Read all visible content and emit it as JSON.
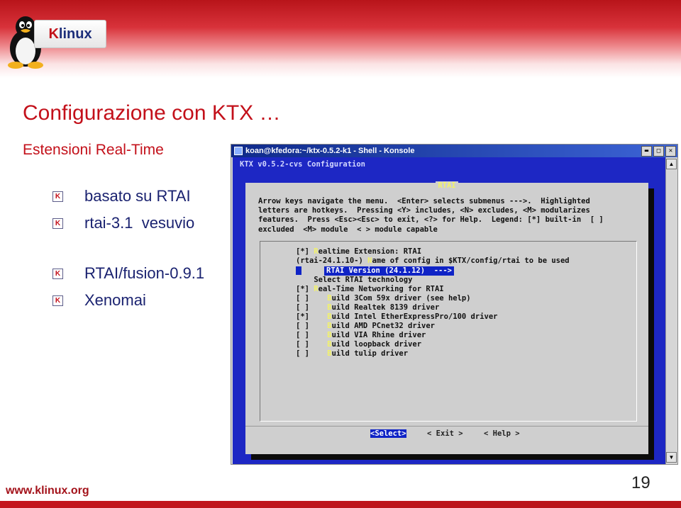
{
  "logo": {
    "k": "K",
    "text": "linux"
  },
  "slide": {
    "title": "Configurazione con KTX …",
    "subtitle": "Estensioni Real-Time",
    "bullets": [
      {
        "mark": "K",
        "text": "basato su RTAI"
      },
      {
        "mark": "K",
        "text": "rtai-3.1  vesuvio"
      },
      {
        "mark": "K",
        "text": "RTAI/fusion-0.9.1"
      },
      {
        "mark": "K",
        "text": "Xenomai"
      }
    ]
  },
  "footer": {
    "url": "www.klinux.org",
    "page": "19"
  },
  "konsole": {
    "window_title": "koan@kfedora:~/ktx-0.5.2-k1 - Shell - Konsole",
    "buttons": {
      "minimize": "▬",
      "maximize": "□",
      "close": "✕"
    },
    "header": "KTX v0.5.2-cvs Configuration",
    "dialog": {
      "title": "RTAI",
      "help": [
        "Arrow keys navigate the menu.  <Enter> selects submenus --->.  Highlighted",
        "letters are hotkeys.  Pressing <Y> includes, <N> excludes, <M> modularizes",
        "features.  Press <Esc><Esc> to exit, <?> for Help.  Legend: [*] built-in  [ ]",
        "excluded  <M> module  < > module capable"
      ],
      "items": [
        {
          "state": "[*]",
          "hotkey": "R",
          "rest": "ealtime Extension: RTAI"
        },
        {
          "state": "(rtai-24.1.10-)",
          "hotkey": "N",
          "rest": "ame of config in $KTX/config/rtai to be used"
        },
        {
          "state": "",
          "hotkey": "",
          "rest": "RTAI Version (24.1.12)  --->"
        },
        {
          "state": "  ",
          "hotkey": "",
          "rest": "Select RTAI technology"
        },
        {
          "state": "[*]",
          "hotkey": "R",
          "rest": "eal-Time Networking for RTAI"
        },
        {
          "state": "[ ]",
          "hotkey": "B",
          "rest": "uild 3Com 59x driver (see help)"
        },
        {
          "state": "[ ]",
          "hotkey": "B",
          "rest": "uild Realtek 8139 driver"
        },
        {
          "state": "[*]",
          "hotkey": "B",
          "rest": "uild Intel EtherExpressPro/100 driver"
        },
        {
          "state": "[ ]",
          "hotkey": "B",
          "rest": "uild AMD PCnet32 driver"
        },
        {
          "state": "[ ]",
          "hotkey": "B",
          "rest": "uild VIA Rhine driver"
        },
        {
          "state": "[ ]",
          "hotkey": "B",
          "rest": "uild loopback driver"
        },
        {
          "state": "[ ]",
          "hotkey": "B",
          "rest": "uild tulip driver"
        }
      ],
      "btn_select": "<Select>",
      "btn_exit": "< Exit >",
      "btn_help": "< Help >"
    }
  },
  "colors": {
    "accent_red": "#c3101a",
    "bullet_blue": "#1a2270",
    "terminal_blue": "#1d27c4",
    "hotkey_yellow": "#f2f26a"
  }
}
